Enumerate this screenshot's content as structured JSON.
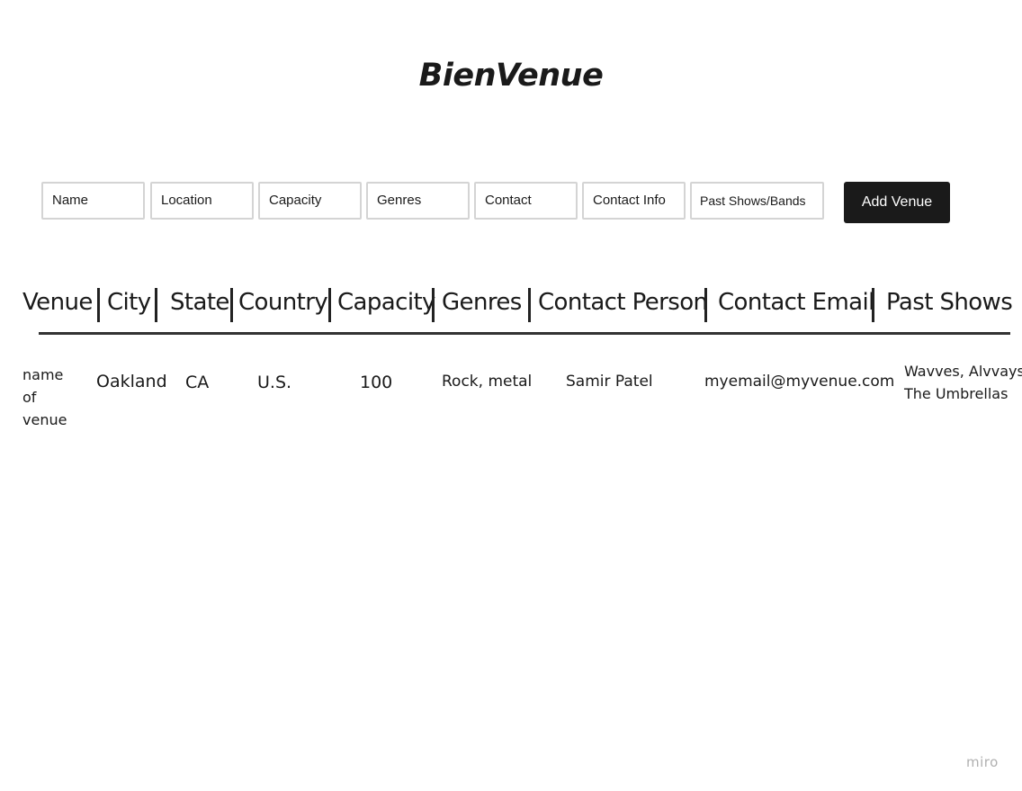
{
  "app": {
    "title": "BienVenue",
    "watermark": "miro"
  },
  "form": {
    "fields": [
      {
        "label": "Name"
      },
      {
        "label": "Location"
      },
      {
        "label": "Capacity"
      },
      {
        "label": "Genres"
      },
      {
        "label": "Contact"
      },
      {
        "label": "Contact Info"
      },
      {
        "label": "Past Shows/Bands"
      }
    ],
    "submit_label": "Add Venue"
  },
  "table": {
    "columns": [
      "Venue",
      "City",
      "State",
      "Country",
      "Capacity",
      "Genres",
      "Contact Person",
      "Contact Email",
      "Past Shows"
    ],
    "rows": [
      {
        "venue_lines": [
          "name",
          "of",
          "venue"
        ],
        "city": "Oakland",
        "state": "CA",
        "country": "U.S.",
        "capacity": "100",
        "genres": "Rock, metal",
        "contact_person": "Samir Patel",
        "contact_email": "myemail@myvenue.com",
        "past_shows_lines": [
          "Wavves, Alvvays,",
          "The Umbrellas"
        ]
      }
    ]
  },
  "colors": {
    "text": "#1a1a1a",
    "button_bg": "#1a1a1a",
    "field_border": "#d4d4d4",
    "watermark": "#b0b0b0"
  }
}
